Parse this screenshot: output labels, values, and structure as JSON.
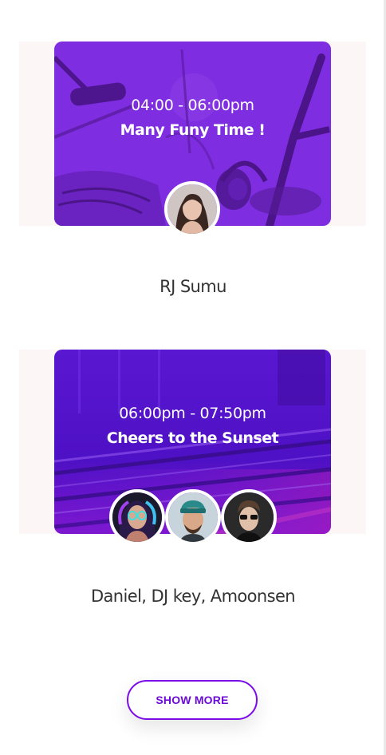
{
  "shows": [
    {
      "time": "04:00 - 06:00pm",
      "title": "Many Funy Time !",
      "hosts": "RJ Sumu"
    },
    {
      "time": "06:00pm - 07:50pm",
      "title": "Cheers to the Sunset",
      "hosts": "Daniel, DJ key, Amoonsen"
    }
  ],
  "show_more_label": "SHOW MORE",
  "colors": {
    "accent": "#7b0be8",
    "overlay_1": "#8a2be2",
    "overlay_2": "#6a0ad6",
    "text_dark": "#333333"
  }
}
